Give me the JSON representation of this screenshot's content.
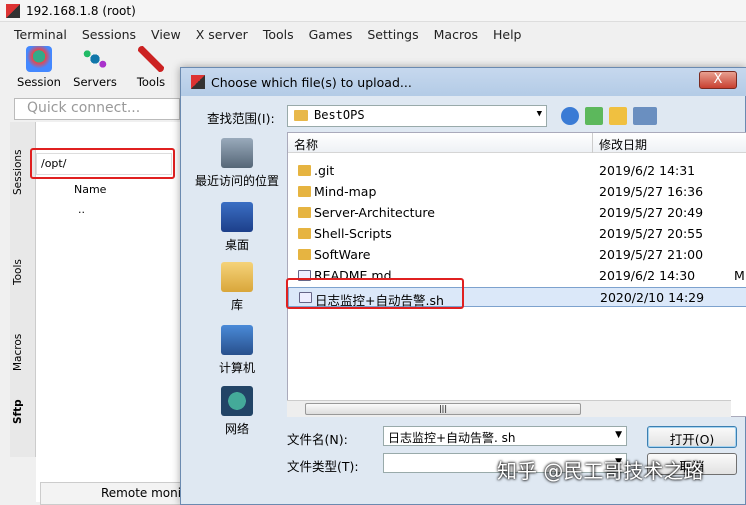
{
  "window": {
    "title": "192.168.1.8 (root)"
  },
  "menu": [
    "Terminal",
    "Sessions",
    "View",
    "X server",
    "Tools",
    "Games",
    "Settings",
    "Macros",
    "Help"
  ],
  "toolbar": [
    {
      "label": "Session",
      "icon": "session-icon"
    },
    {
      "label": "Servers",
      "icon": "servers-icon"
    },
    {
      "label": "Tools",
      "icon": "tools-icon"
    }
  ],
  "quick_connect": {
    "placeholder": "Quick connect..."
  },
  "side_tabs": [
    "Sessions",
    "Tools",
    "Macros",
    "Sftp"
  ],
  "sftp": {
    "path": "/opt/",
    "column": "Name",
    "parent": ".."
  },
  "remote_tab": "Remote moni",
  "dialog": {
    "title": "Choose which file(s) to upload...",
    "close": "X",
    "look_in_label": "查找范围(I):",
    "look_in_value": "BestOPS",
    "places": [
      "最近访问的位置",
      "桌面",
      "库",
      "计算机",
      "网络"
    ],
    "columns": {
      "name": "名称",
      "date": "修改日期"
    },
    "rows": [
      {
        "name": ".git",
        "date": "2019/6/2 14:31",
        "type": "folder"
      },
      {
        "name": "Mind-map",
        "date": "2019/5/27 16:36",
        "type": "folder"
      },
      {
        "name": "Server-Architecture",
        "date": "2019/5/27 20:49",
        "type": "folder"
      },
      {
        "name": "Shell-Scripts",
        "date": "2019/5/27 20:55",
        "type": "folder"
      },
      {
        "name": "SoftWare",
        "date": "2019/5/27 21:00",
        "type": "folder"
      },
      {
        "name": "README.md",
        "date": "2019/6/2 14:30",
        "type": "file",
        "extra": "M"
      },
      {
        "name": "日志监控+自动告警.sh",
        "date": "2020/2/10 14:29",
        "type": "file"
      }
    ],
    "filename_label": "文件名(N):",
    "filename_value": "日志监控+自动告警. sh",
    "filetype_label": "文件类型(T):",
    "open_button": "打开(O)",
    "cancel_button": "取消"
  },
  "watermark": "知乎 @民工哥技术之路"
}
